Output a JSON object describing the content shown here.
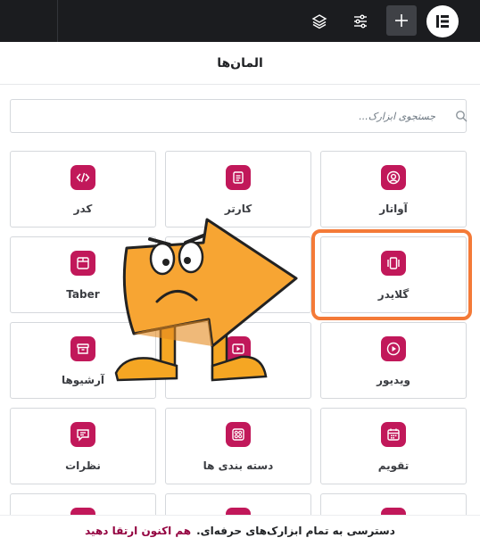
{
  "topbar": {
    "icons": [
      "layers-icon",
      "sliders-icon",
      "plus-icon",
      "elementor-logo"
    ]
  },
  "panel": {
    "title": "المان‌ها"
  },
  "search": {
    "placeholder": "جستجوی ابزارک..."
  },
  "widgets": [
    {
      "label": "آواتار",
      "icon": "avatar-icon"
    },
    {
      "label": "کارتر",
      "icon": "card-icon"
    },
    {
      "label": "کدر",
      "icon": "code-icon"
    },
    {
      "label": "گلایدر",
      "icon": "slider-icon"
    },
    {
      "label": "",
      "icon": ""
    },
    {
      "label": "Taber",
      "icon": "tabs-icon"
    },
    {
      "label": "ویدیور",
      "icon": "video-icon"
    },
    {
      "label": "",
      "icon": "video-icon"
    },
    {
      "label": "آرشیوها",
      "icon": "archive-icon"
    },
    {
      "label": "تقویم",
      "icon": "calendar-icon"
    },
    {
      "label": "دسته بندی ها",
      "icon": "categories-icon"
    },
    {
      "label": "نظرات",
      "icon": "comments-icon"
    }
  ],
  "promo": {
    "text": "دسترسی به تمام ابزارک‌های حرفه‌ای.",
    "link": "هم اکنون ارتقا دهید"
  },
  "colors": {
    "topbar": "#1b1c1f",
    "accent": "#c1185a",
    "highlight": "#f47a38",
    "promo_link": "#93003f"
  }
}
